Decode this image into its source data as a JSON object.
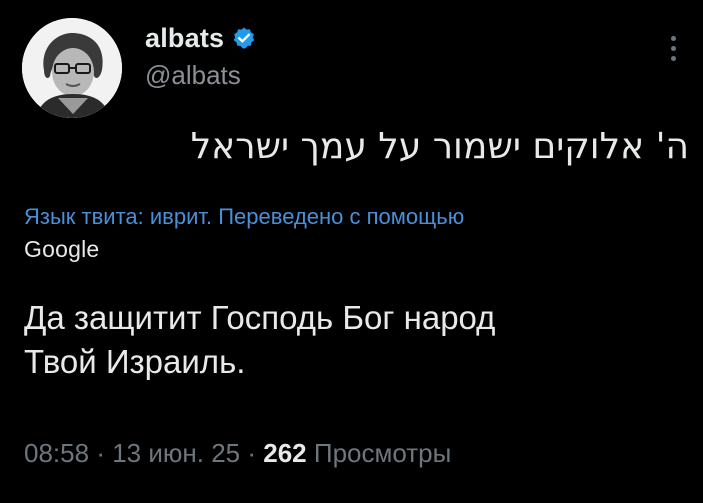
{
  "author": {
    "display_name": "albats",
    "handle": "@albats",
    "verified": true,
    "accent_color": "#1d9bf0"
  },
  "tweet": {
    "original_text": "ה' אלוקים ישמור על עמך ישראל",
    "translation_note": "Язык твита: иврит. Переведено с помощью",
    "translation_provider": "Google",
    "translated_text_line1": "Да защитит Господь Бог народ",
    "translated_text_line2": "Твой Израиль."
  },
  "meta": {
    "time": "08:58",
    "separator": "·",
    "date": "13 июн. 25",
    "views_count": "262",
    "views_label": "Просмотры"
  },
  "colors": {
    "background": "#000000",
    "text": "#e7e9ea",
    "secondary": "#6e767d",
    "link": "#4a90d9"
  },
  "icons": {
    "verified": "verified-badge-icon",
    "more": "more-options-icon"
  }
}
